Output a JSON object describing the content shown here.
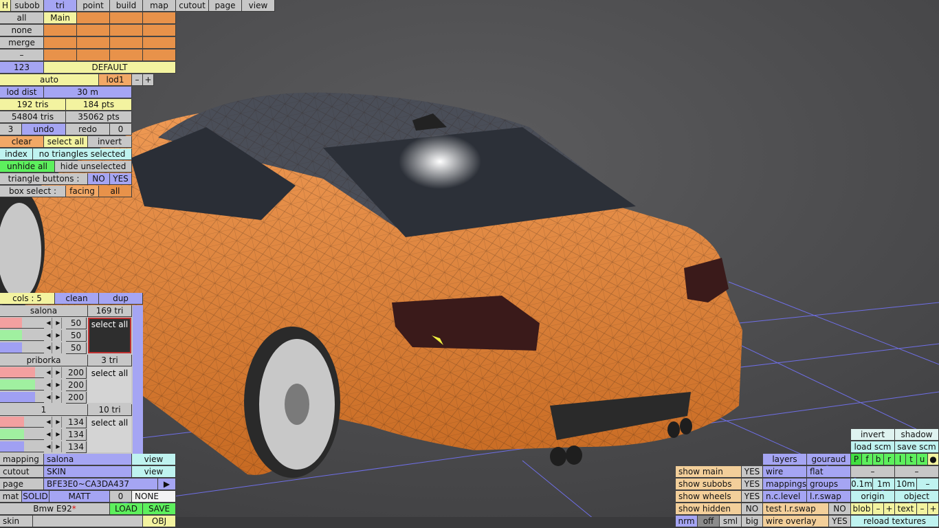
{
  "topbar": {
    "h": "H",
    "tabs": [
      "subob",
      "tri",
      "point",
      "build",
      "map",
      "cutout",
      "page",
      "view"
    ]
  },
  "subob": {
    "all": "all",
    "none": "none",
    "merge": "merge",
    "minus": "–",
    "count": "123",
    "main": "Main",
    "default": "DEFAULT"
  },
  "lod": {
    "auto": "auto",
    "lod": "lod1",
    "minus": "–",
    "plus": "+",
    "dist_label": "lod dist",
    "dist_value": "30 m"
  },
  "stats": {
    "sel_tris": "192 tris",
    "sel_pts": "184 pts",
    "tot_tris": "54804 tris",
    "tot_pts": "35062 pts"
  },
  "history": {
    "undo_count": "3",
    "undo": "undo",
    "redo": "redo",
    "redo_count": "0"
  },
  "selection": {
    "clear": "clear",
    "select_all": "select all",
    "invert": "invert",
    "index": "index",
    "status": "no triangles selected",
    "unhide_all": "unhide all",
    "hide_unselected": "hide unselected",
    "tri_buttons": "triangle buttons :",
    "no": "NO",
    "yes": "YES",
    "box_select": "box select :",
    "facing": "facing",
    "all": "all"
  },
  "materials": {
    "cols": "cols : 5",
    "clean": "clean",
    "dup": "dup",
    "items": [
      {
        "name": "salona",
        "tris": "169 tri",
        "values": [
          "50",
          "50",
          "50"
        ],
        "button": "select all"
      },
      {
        "name": "priborka",
        "tris": "3 tri",
        "values": [
          "200",
          "200",
          "200"
        ],
        "button": "select all"
      },
      {
        "name": "1",
        "tris": "10 tri",
        "values": [
          "134",
          "134",
          "134"
        ],
        "button": "select all"
      }
    ]
  },
  "bottom_left": {
    "mapping": "mapping",
    "mapping_value": "salona",
    "view1": "view",
    "cutout": "cutout",
    "cutout_value": "SKIN",
    "view2": "view",
    "page": "page",
    "page_value": "BFE3E0~CA3DA437",
    "page_arrow": "▶",
    "mat": "mat",
    "solid": "SOLID",
    "matt": "MATT",
    "zero": "0",
    "none": "NONE",
    "model": "Bmw E92",
    "modified": "*",
    "load": "LOAD",
    "save": "SAVE",
    "skin": "skin",
    "obj": "OBJ"
  },
  "bottom_right": {
    "show_main": "show main",
    "show_main_v": "YES",
    "show_subobs": "show subobs",
    "show_subobs_v": "YES",
    "show_wheels": "show wheels",
    "show_wheels_v": "YES",
    "show_hidden": "show hidden",
    "show_hidden_v": "NO",
    "nrm": "nrm",
    "off": "off",
    "sml": "sml",
    "big": "big",
    "layers": "layers",
    "gouraud": "gouraud",
    "wire": "wire",
    "flat": "flat",
    "mappings": "mappings",
    "groups": "groups",
    "nclevel": "n.c.level",
    "lrswap": "l.r.swap",
    "test_lrswap": "test l.r.swap",
    "test_lrswap_v": "NO",
    "wire_overlay": "wire overlay",
    "wire_overlay_v": "YES",
    "invert": "invert",
    "shadow": "shadow",
    "load_scm": "load scm",
    "save_scm": "save scm",
    "pfbrltu": [
      "P",
      "f",
      "b",
      "r",
      "l",
      "t",
      "u"
    ],
    "dot": "●",
    "minus": "–",
    "d01": "0.1m",
    "d1": "1m",
    "d10": "10m",
    "origin": "origin",
    "object": "object",
    "blob": "blob",
    "text": "text",
    "plus": "+",
    "reload": "reload textures"
  },
  "colors": {
    "panel_gray": "#c7c7c7",
    "blue": "#a5a5f3",
    "yellow": "#f3f3a0",
    "orange": "#e8924a",
    "cyan": "#bff3f0",
    "green": "#5df05d",
    "car_body": "#e0843a",
    "background": "#505052"
  }
}
